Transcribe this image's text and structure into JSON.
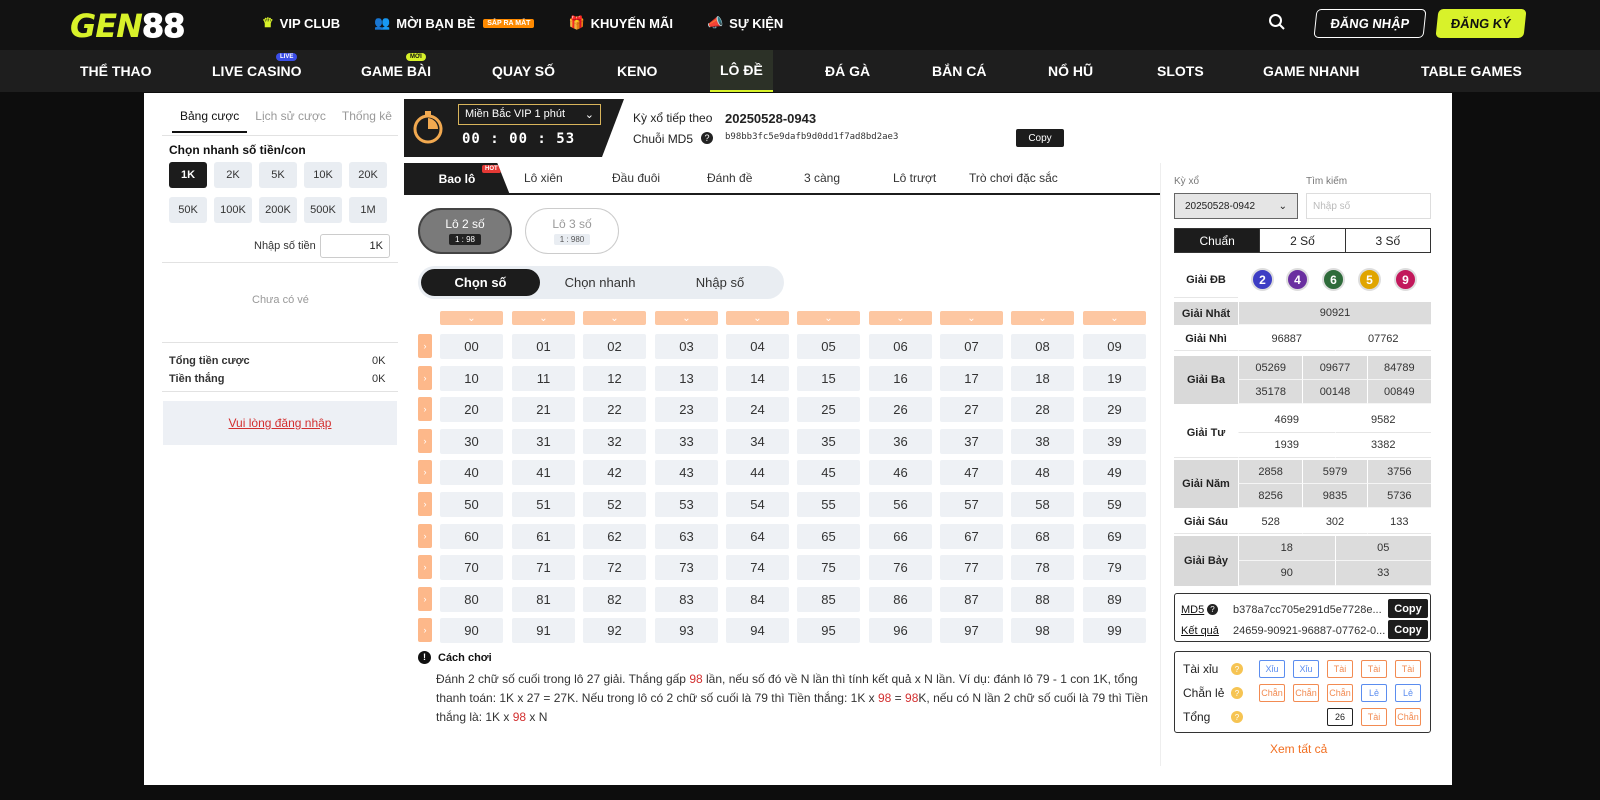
{
  "brand": {
    "logo_a": "GEN",
    "logo_b": "88"
  },
  "topmenu": [
    {
      "label": "VIP CLUB",
      "icon": "crown-icon"
    },
    {
      "label": "MỜI BẠN BÈ",
      "icon": "friends-icon",
      "badge": "SẮP RA MẮT"
    },
    {
      "label": "KHUYẾN MÃI",
      "icon": "gift-icon"
    },
    {
      "label": "SỰ KIỆN",
      "icon": "megaphone-icon"
    }
  ],
  "auth": {
    "login": "ĐĂNG NHẬP",
    "register": "ĐĂNG KÝ"
  },
  "nav": [
    {
      "label": "THỂ THAO"
    },
    {
      "label": "LIVE CASINO",
      "badge": "LIVE"
    },
    {
      "label": "GAME BÀI",
      "badge": "MỚI"
    },
    {
      "label": "QUAY SỐ"
    },
    {
      "label": "KENO"
    },
    {
      "label": "LÔ ĐỀ"
    },
    {
      "label": "ĐÁ GÀ"
    },
    {
      "label": "BẮN CÁ"
    },
    {
      "label": "NỔ HŨ"
    },
    {
      "label": "SLOTS"
    },
    {
      "label": "GAME NHANH"
    },
    {
      "label": "TABLE GAMES"
    }
  ],
  "left": {
    "tabs": [
      "Bảng cược",
      "Lịch sử cược",
      "Thống kê"
    ],
    "quick_title": "Chọn nhanh số tiền/con",
    "amounts": [
      "1K",
      "2K",
      "5K",
      "10K",
      "20K",
      "50K",
      "100K",
      "200K",
      "500K",
      "1M"
    ],
    "input_label": "Nhập số tiền",
    "input_value": "1K",
    "empty": "Chưa có vé",
    "total_label": "Tổng tiền cược",
    "total_value": "0K",
    "win_label": "Tiền thắng",
    "win_value": "0K",
    "login_prompt": "Vui lòng đăng nhập"
  },
  "header": {
    "region": "Miền Bắc VIP 1 phút",
    "timer": "00 : 00 : 53",
    "next_label": "Kỳ xổ tiếp theo",
    "next_value": "20250528-0943",
    "md5_label": "Chuỗi MD5",
    "md5_value": "b98bb3fc5e9dafb9d0dd1f7ad8bd2ae3",
    "copy": "Copy"
  },
  "bet_tabs": [
    {
      "label": "Bao lô",
      "badge": "HOT"
    },
    {
      "label": "Lô xiên"
    },
    {
      "label": "Đầu đuôi"
    },
    {
      "label": "Đánh đề"
    },
    {
      "label": "3 càng"
    },
    {
      "label": "Lô trượt"
    },
    {
      "label": "Trò chơi đặc sắc"
    }
  ],
  "types": [
    {
      "label": "Lô 2 số",
      "rate": "1 : 98"
    },
    {
      "label": "Lô 3 số",
      "rate": "1 : 980"
    }
  ],
  "modes": [
    "Chọn số",
    "Chọn nhanh",
    "Nhập số"
  ],
  "numbers": [
    "00",
    "01",
    "02",
    "03",
    "04",
    "05",
    "06",
    "07",
    "08",
    "09",
    "10",
    "11",
    "12",
    "13",
    "14",
    "15",
    "16",
    "17",
    "18",
    "19",
    "20",
    "21",
    "22",
    "23",
    "24",
    "25",
    "26",
    "27",
    "28",
    "29",
    "30",
    "31",
    "32",
    "33",
    "34",
    "35",
    "36",
    "37",
    "38",
    "39",
    "40",
    "41",
    "42",
    "43",
    "44",
    "45",
    "46",
    "47",
    "48",
    "49",
    "50",
    "51",
    "52",
    "53",
    "54",
    "55",
    "56",
    "57",
    "58",
    "59",
    "60",
    "61",
    "62",
    "63",
    "64",
    "65",
    "66",
    "67",
    "68",
    "69",
    "70",
    "71",
    "72",
    "73",
    "74",
    "75",
    "76",
    "77",
    "78",
    "79",
    "80",
    "81",
    "82",
    "83",
    "84",
    "85",
    "86",
    "87",
    "88",
    "89",
    "90",
    "91",
    "92",
    "93",
    "94",
    "95",
    "96",
    "97",
    "98",
    "99"
  ],
  "howto": {
    "title": "Cách chơi",
    "t1": "Đánh 2 chữ số cuối trong lô 27 giải. Thắng gấp ",
    "r1": "98",
    "t2": " lần, nếu số đó về N lần thì tính kết quả x N lần. Ví dụ: đánh lô 79 - 1 con 1K, tổng thanh toán: 1K x 27 = 27K. Nếu trong lô có 2 chữ số cuối là 79 thì Tiền thắng: 1K x ",
    "r2": "98",
    "t3": " = ",
    "r3": "98",
    "t4": "K, nếu có N lần 2 chữ số cuối là 79 thì Tiền thắng là: 1K x ",
    "r4": "98",
    "t5": " x N"
  },
  "results": {
    "draw_label": "Kỳ xổ",
    "draw_value": "20250528-0942",
    "search_label": "Tìm kiếm",
    "search_placeholder": "Nhập số",
    "views": [
      "Chuẩn",
      "2 Số",
      "3 Số"
    ],
    "db_label": "Giải ĐB",
    "db_balls": [
      {
        "n": "2",
        "color": "#3d3dc4"
      },
      {
        "n": "4",
        "color": "#6a2fa0"
      },
      {
        "n": "6",
        "color": "#2e6b3a"
      },
      {
        "n": "5",
        "color": "#e0a500"
      },
      {
        "n": "9",
        "color": "#c2185b"
      }
    ],
    "nhat": {
      "label": "Giải Nhất",
      "vals": [
        "90921"
      ]
    },
    "nhi": {
      "label": "Giải Nhì",
      "vals": [
        "96887",
        "07762"
      ]
    },
    "ba": {
      "label": "Giải Ba",
      "vals": [
        "05269",
        "09677",
        "84789",
        "35178",
        "00148",
        "00849"
      ]
    },
    "tu": {
      "label": "Giải Tư",
      "vals": [
        "4699",
        "9582",
        "1939",
        "3382"
      ]
    },
    "nam": {
      "label": "Giải Năm",
      "vals": [
        "2858",
        "5979",
        "3756",
        "8256",
        "9835",
        "5736"
      ]
    },
    "sau": {
      "label": "Giải Sáu",
      "vals": [
        "528",
        "302",
        "133"
      ]
    },
    "bay": {
      "label": "Giải Bảy",
      "vals": [
        "18",
        "05",
        "90",
        "33"
      ]
    },
    "md5_label": "MD5",
    "md5_value": "b378a7cc705e291d5e7728e...",
    "kq_label": "Kết quả",
    "kq_value": "24659-90921-96887-07762-0...",
    "copy": "Copy",
    "stats": [
      {
        "label": "Tài xỉu",
        "chips": [
          [
            "Xỉu",
            "b"
          ],
          [
            "Xỉu",
            "b"
          ],
          [
            "Tài",
            "o"
          ],
          [
            "Tài",
            "o"
          ],
          [
            "Tài",
            "o"
          ]
        ]
      },
      {
        "label": "Chẵn lẻ",
        "chips": [
          [
            "Chẵn",
            "o"
          ],
          [
            "Chẵn",
            "o"
          ],
          [
            "Chẵn",
            "o"
          ],
          [
            "Lẻ",
            "b"
          ],
          [
            "Lẻ",
            "b"
          ]
        ]
      },
      {
        "label": "Tổng",
        "chips": [
          [
            "26",
            "k"
          ],
          [
            "Tài",
            "o"
          ],
          [
            "Chẵn",
            "o"
          ]
        ]
      }
    ],
    "view_all": "Xem tất cả"
  }
}
